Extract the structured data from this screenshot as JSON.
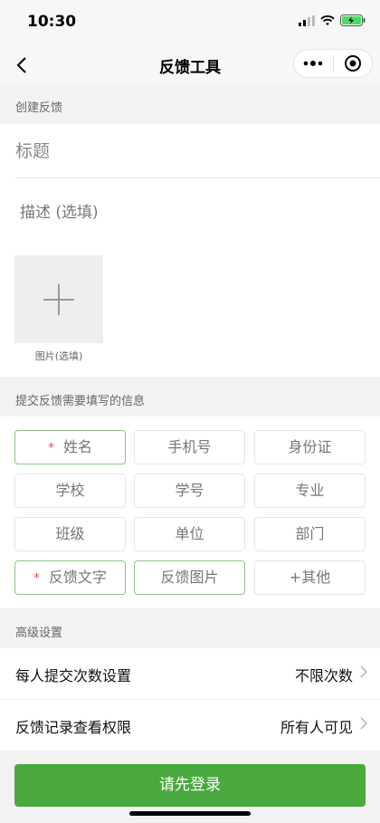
{
  "status_bar": {
    "time": "10:30"
  },
  "nav": {
    "title": "反馈工具",
    "back_icon": "chevron-left-icon",
    "more_icon": "more-dots-icon",
    "close_icon": "target-circle-icon"
  },
  "create_section": {
    "header": "创建反馈",
    "title_placeholder": "标题",
    "description_placeholder": "描述 (选填)",
    "image_caption": "图片(选填)"
  },
  "fields_section": {
    "header": "提交反馈需要填写的信息",
    "required_mark": "*",
    "fields": [
      {
        "label": "姓名",
        "required": true,
        "selected": true
      },
      {
        "label": "手机号",
        "required": false,
        "selected": false
      },
      {
        "label": "身份证",
        "required": false,
        "selected": false
      },
      {
        "label": "学校",
        "required": false,
        "selected": false
      },
      {
        "label": "学号",
        "required": false,
        "selected": false
      },
      {
        "label": "专业",
        "required": false,
        "selected": false
      },
      {
        "label": "班级",
        "required": false,
        "selected": false
      },
      {
        "label": "单位",
        "required": false,
        "selected": false
      },
      {
        "label": "部门",
        "required": false,
        "selected": false
      },
      {
        "label": "反馈文字",
        "required": true,
        "selected": true
      },
      {
        "label": "反馈图片",
        "required": false,
        "selected": true
      },
      {
        "label": "+其他",
        "required": false,
        "selected": false
      }
    ]
  },
  "advanced_section": {
    "header": "高级设置",
    "rows": [
      {
        "label": "每人提交次数设置",
        "value": "不限次数"
      },
      {
        "label": "反馈记录查看权限",
        "value": "所有人可见"
      }
    ]
  },
  "login_button": {
    "label": "请先登录"
  },
  "colors": {
    "primary_green": "#4aa93e",
    "selected_border": "#8fc28a",
    "required_red": "#e05555"
  }
}
